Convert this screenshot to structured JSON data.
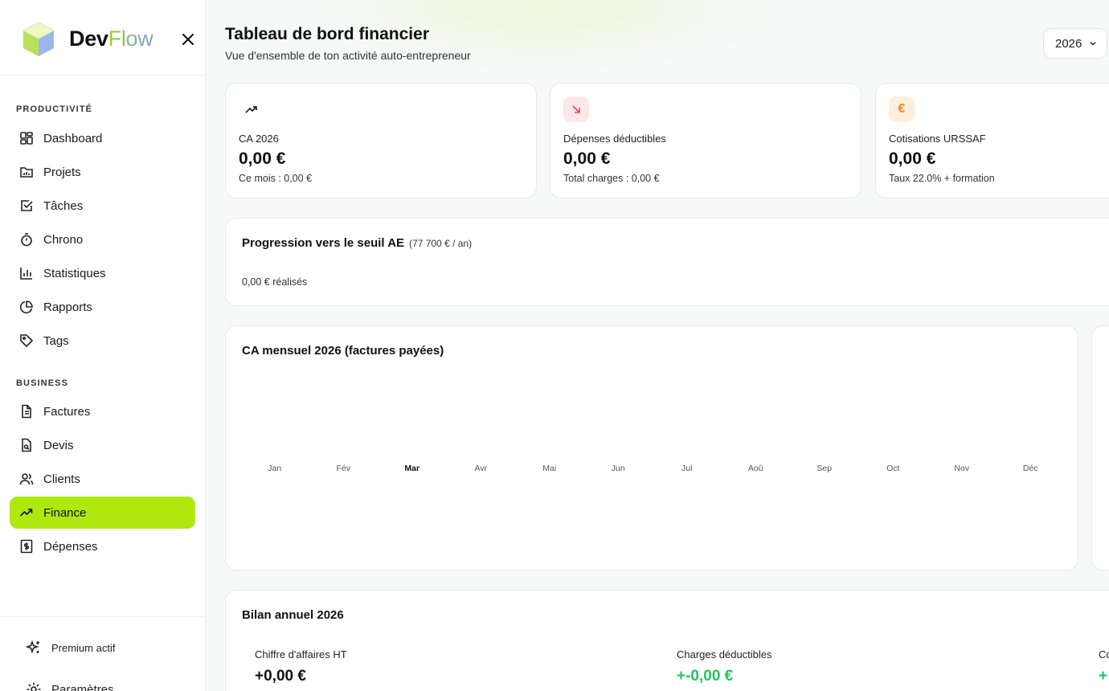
{
  "brand": {
    "name_dev": "Dev",
    "name_flow": "Flow"
  },
  "sidebar": {
    "sections": [
      {
        "title": "PRODUCTIVITÉ",
        "items": [
          {
            "label": "Dashboard",
            "icon": "layout-grid-icon"
          },
          {
            "label": "Projets",
            "icon": "folder-icon"
          },
          {
            "label": "Tâches",
            "icon": "checkbox-icon"
          },
          {
            "label": "Chrono",
            "icon": "stopwatch-icon"
          },
          {
            "label": "Statistiques",
            "icon": "bar-chart-icon"
          },
          {
            "label": "Rapports",
            "icon": "pie-chart-icon"
          },
          {
            "label": "Tags",
            "icon": "tag-icon"
          }
        ]
      },
      {
        "title": "BUSINESS",
        "items": [
          {
            "label": "Factures",
            "icon": "file-text-icon"
          },
          {
            "label": "Devis",
            "icon": "file-search-icon"
          },
          {
            "label": "Clients",
            "icon": "users-icon"
          },
          {
            "label": "Finance",
            "icon": "trending-up-icon",
            "active": true
          },
          {
            "label": "Dépenses",
            "icon": "receipt-dollar-icon"
          }
        ]
      }
    ],
    "footer": {
      "premium": "Premium actif",
      "settings": "Paramètres"
    }
  },
  "header": {
    "title": "Tableau de bord financier",
    "subtitle": "Vue d'ensemble de ton activité auto-entrepreneur",
    "year": "2026"
  },
  "stats": [
    {
      "label": "CA 2026",
      "value": "0,00 €",
      "sub": "Ce mois : 0,00 €",
      "icon": "trending-up-icon",
      "icon_bg": "#ffffff",
      "icon_color": "#222222"
    },
    {
      "label": "Dépenses déductibles",
      "value": "0,00 €",
      "sub": "Total charges : 0,00 €",
      "icon": "arrow-down-right-icon",
      "icon_bg": "#fde7e9",
      "icon_color": "#e0485a"
    },
    {
      "label": "Cotisations URSSAF",
      "value": "0,00 €",
      "sub": "Taux 22.0% + formation",
      "icon": "euro-icon",
      "icon_bg": "#fdeede",
      "icon_color": "#f08a24"
    }
  ],
  "progress": {
    "title": "Progression vers le seuil AE",
    "note": "(77 700 € / an)",
    "done": "0,00 € réalisés",
    "fraction": 0
  },
  "chart_data": {
    "type": "bar",
    "title": "CA mensuel 2026 (factures payées)",
    "categories": [
      "Jan",
      "Fév",
      "Mar",
      "Avr",
      "Mai",
      "Jun",
      "Jul",
      "Aoû",
      "Sep",
      "Oct",
      "Nov",
      "Déc"
    ],
    "values": [
      0,
      0,
      0,
      0,
      0,
      0,
      0,
      0,
      0,
      0,
      0,
      0
    ],
    "highlight": "Mar"
  },
  "bilan": {
    "title": "Bilan annuel 2026",
    "items": [
      {
        "label": "Chiffre d'affaires HT",
        "value": "+0,00 €",
        "color": "#111111"
      },
      {
        "label": "Charges déductibles",
        "value": "+-0,00 €",
        "color": "#22c55e"
      },
      {
        "label": "Co",
        "value": "+",
        "color": "#22c55e"
      }
    ]
  },
  "colors": {
    "accent": "#aee80e",
    "positive": "#22c55e"
  }
}
